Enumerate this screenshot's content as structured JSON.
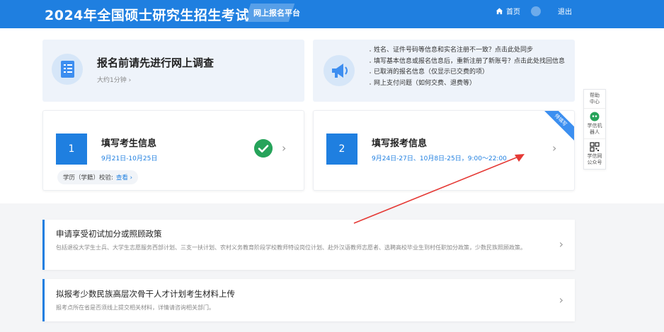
{
  "header": {
    "title": "2024年全国硕士研究生招生考试",
    "platform": "网上报名平台",
    "home_label": "首页",
    "logout_label": "退出"
  },
  "survey": {
    "title": "报名前请先进行网上调查",
    "subtitle": "大约1分钟 ›"
  },
  "notices": [
    "姓名、证件号码等信息和实名注册不一致？点击此处同步",
    "填写基本信息或报名信息后，重新注册了新账号？点击此处找回信息",
    "已取消的报名信息（仅显示已交费的项）",
    "网上支付问题（如何交费、退费等）"
  ],
  "steps": [
    {
      "number": "1",
      "title": "填写考生信息",
      "date": "9月21日-10月25日",
      "verify_label": "学历（学籍）校验:",
      "verify_link": "查看 ›"
    },
    {
      "number": "2",
      "title": "填写报考信息",
      "date": "9月24日-27日、10月8日-25日，9:00～22:00",
      "ribbon": "待填写"
    }
  ],
  "policies": [
    {
      "title": "申请享受初试加分或照顾政策",
      "desc": "包括退役大学生士兵、大学生志愿服务西部计划、三支一扶计划、农村义务教育阶段学校教师特设岗位计划、赴外汉语教师志愿者、选聘高校毕业生到村任职加分政策，少数民族照顾政策。"
    },
    {
      "title": "拟报考少数民族高层次骨干人才计划考生材料上传",
      "desc": "报考点所在省是否须线上提交相关材料，详情请咨询相关部门。"
    }
  ],
  "sidebar": {
    "help": "帮助中心",
    "robot": "学信机器人",
    "wechat": "学信网公众号"
  },
  "colors": {
    "brand": "#1f7fe0",
    "check": "#26a35a",
    "annotation": "#e53935"
  }
}
